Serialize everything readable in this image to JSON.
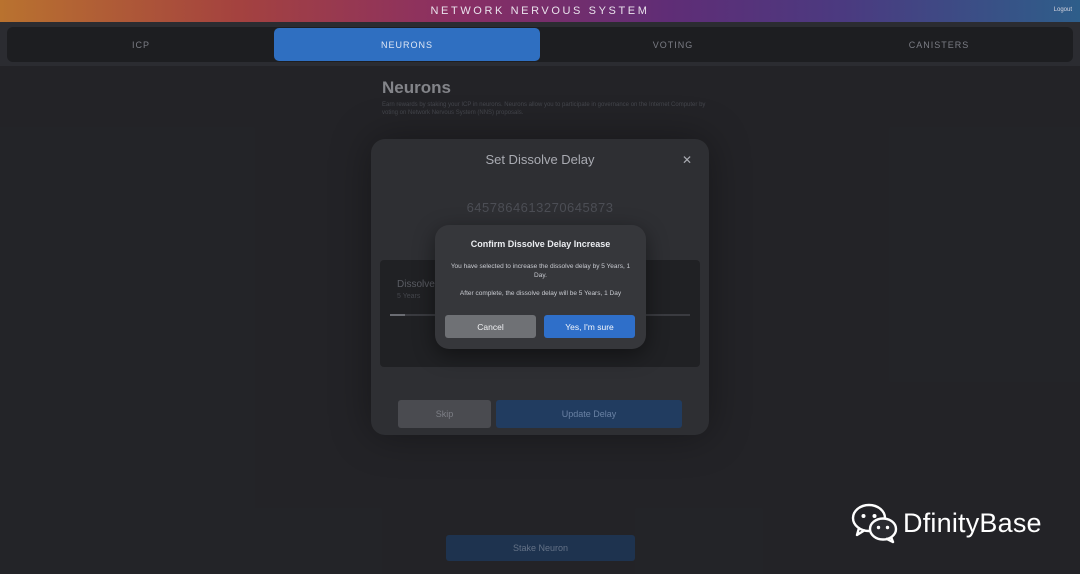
{
  "header": {
    "title": "NETWORK NERVOUS SYSTEM",
    "logout_label": "Logout"
  },
  "tabs": [
    {
      "label": "ICP",
      "active": false
    },
    {
      "label": "NEURONS",
      "active": true
    },
    {
      "label": "VOTING",
      "active": false
    },
    {
      "label": "CANISTERS",
      "active": false
    }
  ],
  "page": {
    "title": "Neurons",
    "description": "Earn rewards by staking your ICP in neurons. Neurons allow you to participate in governance on the Internet Computer by voting on Network Nervous System (NNS) proposals.",
    "stake_button": "Stake Neuron"
  },
  "dissolve_modal": {
    "title": "Set Dissolve Delay",
    "close_icon": "close-icon",
    "neuron_id": "6457864613270645873",
    "panel_label": "Dissolve Delay",
    "panel_sub": "5 Years",
    "slider_fraction": 0.05,
    "skip_label": "Skip",
    "update_label": "Update Delay"
  },
  "confirm_dialog": {
    "title": "Confirm Dissolve Delay Increase",
    "text1": "You have selected to increase the dissolve delay by 5 Years, 1 Day.",
    "text2": "After complete, the dissolve delay will be 5 Years, 1 Day",
    "cancel_label": "Cancel",
    "confirm_label": "Yes, I'm sure"
  },
  "watermark": {
    "text": "DfinityBase",
    "icon": "wechat-icon"
  },
  "colors": {
    "accent": "#2f6fc9",
    "background": "#2b2c31"
  }
}
